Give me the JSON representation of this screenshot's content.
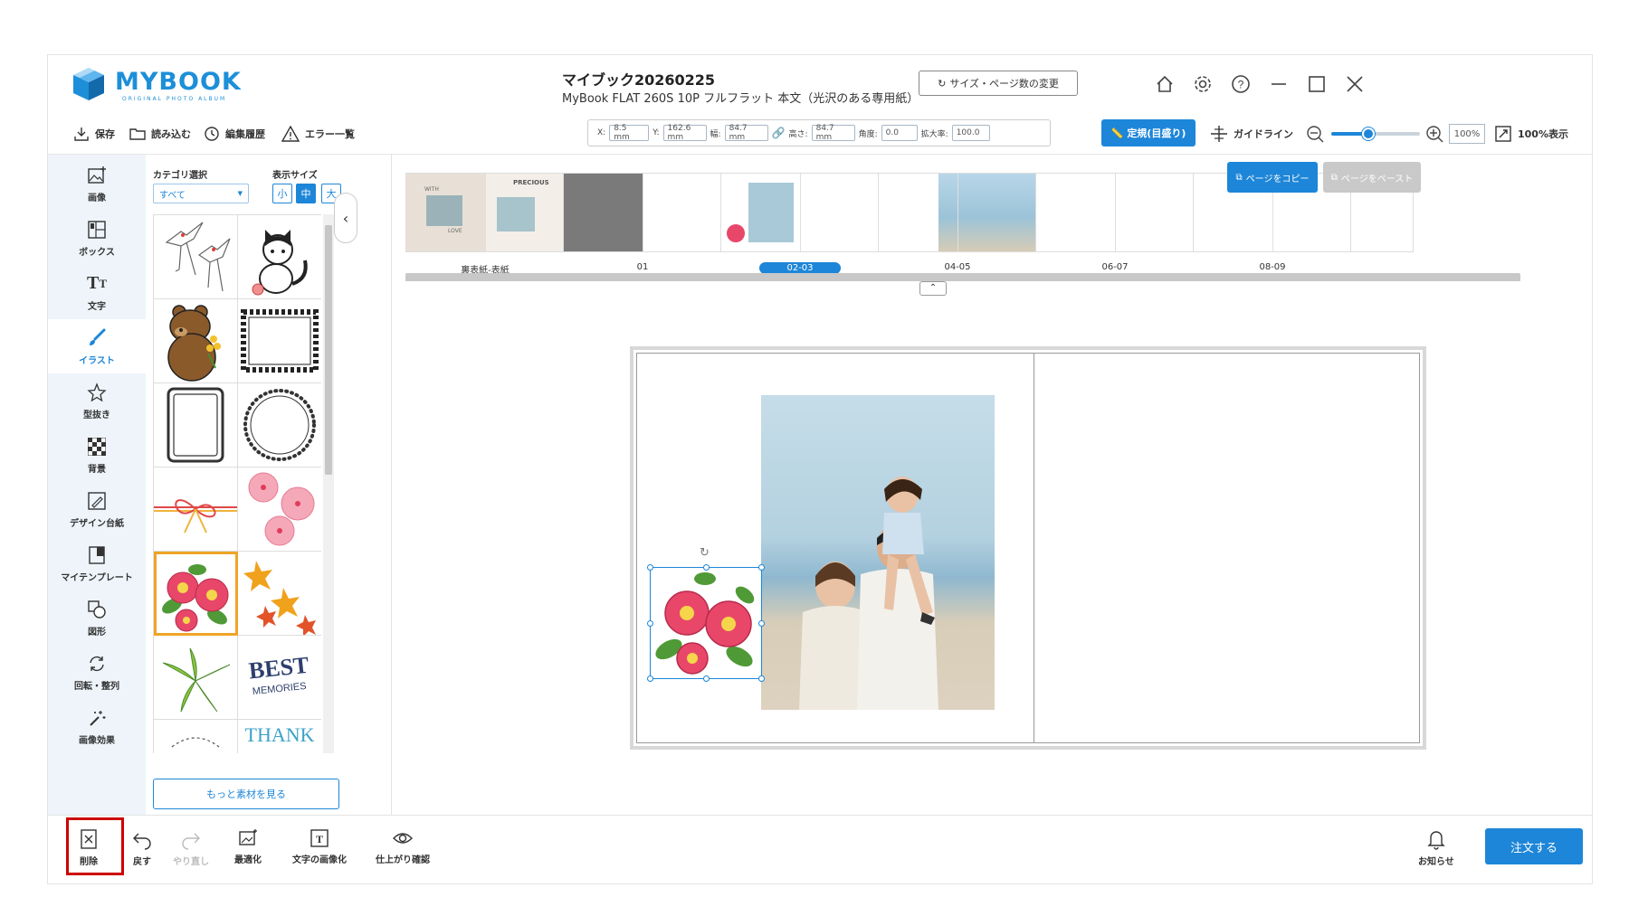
{
  "app": {
    "logo_text": "MYBOOK",
    "logo_sub": "ORIGINAL PHOTO ALBUM",
    "project_title": "マイブック20260225",
    "project_subtitle": "MyBook FLAT 260S 10P フルフラット 本文（光沢のある専用紙）",
    "size_change_label": "サイズ・ページ数の変更"
  },
  "window_controls": [
    "home-icon",
    "settings-icon",
    "help-icon",
    "minimize-icon",
    "maximize-icon",
    "close-icon"
  ],
  "toolbar": {
    "save": "保存",
    "load": "読み込む",
    "history": "編集履歴",
    "errors": "エラー一覧",
    "coords": {
      "x_label": "X:",
      "x_value": "8.5 mm",
      "y_label": "Y:",
      "y_value": "162.6 mm",
      "w_label": "幅:",
      "w_value": "84.7 mm",
      "h_label": "高さ:",
      "h_value": "84.7 mm",
      "angle_label": "角度:",
      "angle_value": "0.0",
      "scale_label": "拡大率:",
      "scale_value": "100.0"
    },
    "ruler_button": "定規(目盛り)",
    "guideline": "ガイドライン",
    "zoom_value": "100%",
    "zoom_level": 0.42,
    "fit_100": "100%表示"
  },
  "sidebar": {
    "items": [
      {
        "label": "画像",
        "icon": "image-add-icon"
      },
      {
        "label": "ボックス",
        "icon": "box-icon"
      },
      {
        "label": "文字",
        "icon": "text-icon"
      },
      {
        "label": "イラスト",
        "icon": "brush-icon",
        "active": true
      },
      {
        "label": "型抜き",
        "icon": "star-cut-icon"
      },
      {
        "label": "背景",
        "icon": "checker-icon"
      },
      {
        "label": "デザイン台紙",
        "icon": "design-mount-icon"
      },
      {
        "label": "マイテンプレート",
        "icon": "template-icon"
      },
      {
        "label": "図形",
        "icon": "shape-icon"
      },
      {
        "label": "回転・整列",
        "icon": "rotate-icon"
      },
      {
        "label": "画像効果",
        "icon": "magic-wand-icon"
      }
    ]
  },
  "panel": {
    "category_label": "カテゴリ選択",
    "category_value": "すべて",
    "display_size_label": "表示サイズ",
    "sizes": [
      "小",
      "中",
      "大"
    ],
    "selected_size": "中",
    "more_button": "もっと素材を見る",
    "cell_texts": {
      "best": "BEST",
      "memories": "MEMORIES",
      "thank": "THANK"
    }
  },
  "thumbnails": {
    "pages": [
      {
        "label": "裏表紙-表紙",
        "text1": "PRECIOUS",
        "text2": "WITH",
        "text3": "LOVE"
      },
      {
        "label": "01"
      },
      {
        "label": "02-03",
        "selected": true
      },
      {
        "label": "04-05"
      },
      {
        "label": "06-07"
      },
      {
        "label": "08-09"
      }
    ],
    "copy_page": "ページをコピー",
    "paste_page": "ページをペースト"
  },
  "navigation": {
    "left_page": "02",
    "right_page": "03"
  },
  "bottombar": {
    "delete": "削除",
    "undo": "戻す",
    "redo": "やり直し",
    "optimize": "最適化",
    "text_to_image": "文字の画像化",
    "preview": "仕上がり確認",
    "notifications": "お知らせ",
    "order": "注文する"
  },
  "colors": {
    "accent": "#1d86d8",
    "highlight": "#cc0000",
    "selection": "#f0a428"
  }
}
